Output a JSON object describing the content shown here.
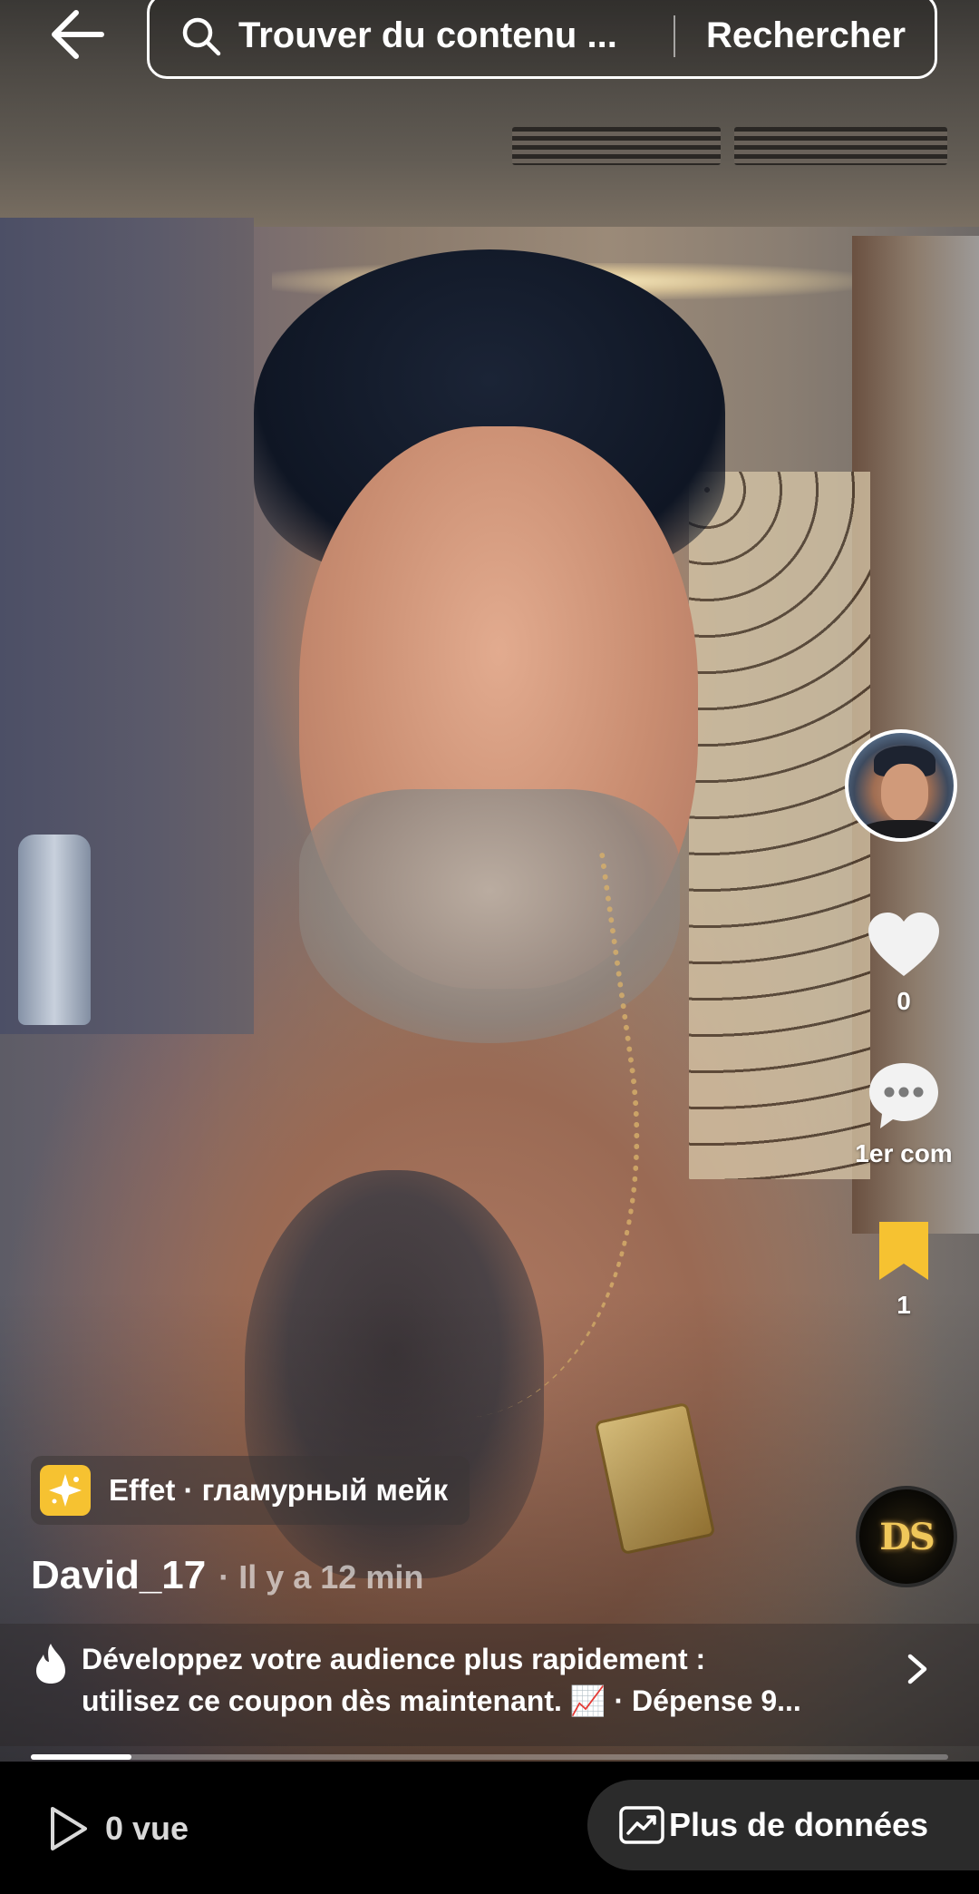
{
  "search": {
    "placeholder": "Trouver du contenu ...",
    "submit_label": "Rechercher"
  },
  "actions": {
    "like_count": "0",
    "comment_label": "1er com",
    "bookmark_count": "1"
  },
  "effect": {
    "label": "Effet · гламурный мейк"
  },
  "post": {
    "author": "David_17",
    "time": "· Il y a 12 min",
    "progress": 0.11
  },
  "promo": {
    "line1": "Développez votre audience plus rapidement :",
    "line2": "utilisez ce coupon dès maintenant. 📈 · Dépense 9..."
  },
  "music": {
    "logo_text": "DS"
  },
  "bottom_bar": {
    "views_label": "0 vue",
    "more_data_label": "Plus de données"
  },
  "colors": {
    "bookmark_active": "#f6c231",
    "effect_icon_bg": "#f6c231",
    "bottom_bar_bg": "#000000",
    "more_data_bg": "#2b2b2b"
  },
  "icons": [
    "back-arrow-icon",
    "search-icon",
    "heart-icon",
    "comment-icon",
    "bookmark-icon",
    "more-icon",
    "effect-sparkle-icon",
    "flame-icon",
    "chevron-right-icon",
    "play-icon",
    "analytics-icon"
  ]
}
